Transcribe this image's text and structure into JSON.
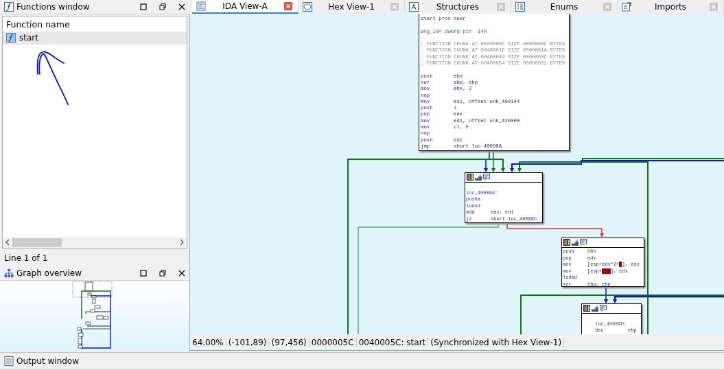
{
  "functions_window": {
    "title": "Functions window",
    "column": "Function name",
    "rows": [
      {
        "name": "start",
        "selected": true
      }
    ],
    "status": "Line 1 of 1"
  },
  "graph_overview": {
    "title": "Graph overview"
  },
  "output_window": {
    "title": "Output window"
  },
  "tabs": [
    {
      "label": "IDA View-A",
      "selected": true
    },
    {
      "label": "Hex View-1",
      "selected": false
    },
    {
      "label": "Structures",
      "selected": false
    },
    {
      "label": "Enums",
      "selected": false
    },
    {
      "label": "Imports",
      "selected": false
    }
  ],
  "nodes": [
    {
      "lines": [
        {
          "kind": "head",
          "text": "start proc near"
        },
        {
          "kind": "blank"
        },
        {
          "kind": "var",
          "text": "arg_10= dword ptr ",
          "num": " 14h"
        },
        {
          "kind": "blank"
        },
        {
          "kind": "comment",
          "text": "; FUNCTION CHUNK AT 0040000C SIZE 0000000C BYTES"
        },
        {
          "kind": "comment",
          "text": "; FUNCTION CHUNK AT 0040001E SIZE 0000001A BYTES"
        },
        {
          "kind": "comment",
          "text": "; FUNCTION CHUNK AT 00400044 SIZE 0000000C BYTES"
        },
        {
          "kind": "comment",
          "text": "; FUNCTION CHUNK AT 00400054 SIZE 00000002 BYTES"
        },
        {
          "kind": "blank"
        },
        {
          "kind": "instr",
          "mnemonic": "push",
          "operand": [
            {
              "kind": "text",
              "text": "ebx"
            }
          ]
        },
        {
          "kind": "instr",
          "mnemonic": "xor",
          "operand": [
            {
              "kind": "text",
              "text": "ebp, ebp"
            }
          ]
        },
        {
          "kind": "instr",
          "mnemonic": "mov",
          "operand": [
            {
              "kind": "text",
              "text": "ebx, "
            },
            {
              "kind": "number",
              "text": "2"
            }
          ]
        },
        {
          "kind": "instr",
          "mnemonic": "nop"
        },
        {
          "kind": "instr",
          "mnemonic": "mov",
          "operand": [
            {
              "kind": "text",
              "text": "esi, offset unk_400144"
            }
          ]
        },
        {
          "kind": "instr",
          "mnemonic": "push",
          "operand": [
            {
              "kind": "number",
              "text": "1"
            }
          ]
        },
        {
          "kind": "instr",
          "mnemonic": "pop",
          "operand": [
            {
              "kind": "text",
              "text": "eax"
            }
          ]
        },
        {
          "kind": "instr",
          "mnemonic": "mov",
          "operand": [
            {
              "kind": "text",
              "text": "edi, offset unk_420000"
            }
          ]
        },
        {
          "kind": "instr",
          "mnemonic": "mov",
          "operand": [
            {
              "kind": "text",
              "text": "cl, "
            },
            {
              "kind": "number",
              "text": "0"
            }
          ]
        },
        {
          "kind": "instr",
          "mnemonic": "nop"
        },
        {
          "kind": "instr",
          "mnemonic": "push",
          "operand": [
            {
              "kind": "text",
              "text": "edi"
            }
          ]
        },
        {
          "kind": "instr",
          "mnemonic": "jmp",
          "operand": [
            {
              "kind": "text",
              "text": "short loc 40008A"
            }
          ]
        }
      ]
    },
    {
      "lines": [
        {
          "kind": "blank"
        },
        {
          "kind": "head",
          "text": "loc_40008A:"
        },
        {
          "kind": "instr",
          "mnemonic": "pusha"
        },
        {
          "kind": "instr",
          "mnemonic": "lodsd"
        },
        {
          "kind": "instr",
          "mnemonic": "add",
          "operand": [
            {
              "kind": "text",
              "text": "eax, edi"
            }
          ]
        },
        {
          "kind": "instr",
          "mnemonic": "jz",
          "operand": [
            {
              "kind": "text",
              "text": "short loc_40008C"
            }
          ]
        }
      ]
    },
    {
      "lines": [
        {
          "kind": "instr",
          "mnemonic": "push",
          "operand": [
            {
              "kind": "number",
              "text": "0Ah"
            }
          ]
        },
        {
          "kind": "instr",
          "mnemonic": "pop",
          "operand": [
            {
              "kind": "text",
              "text": "edx"
            }
          ]
        },
        {
          "kind": "instr",
          "mnemonic": "mov",
          "operand": [
            {
              "kind": "text",
              "text": "[esp+edx*2+"
            },
            {
              "kind": "highlight",
              "text": "8"
            },
            {
              "kind": "text",
              "text": "], edx"
            }
          ]
        },
        {
          "kind": "instr",
          "mnemonic": "mov",
          "operand": [
            {
              "kind": "text",
              "text": "[esp+"
            },
            {
              "kind": "highlight",
              "text": "10h"
            },
            {
              "kind": "text",
              "text": "], edx"
            }
          ]
        },
        {
          "kind": "instr",
          "mnemonic": "lodsd"
        },
        {
          "kind": "instr",
          "mnemonic": "xor",
          "operand": [
            {
              "kind": "text",
              "text": "ebp, ebp"
            }
          ]
        }
      ]
    },
    {
      "lines": [
        {
          "kind": "blank"
        },
        {
          "kind": "head",
          "text": "loc_40009D:"
        },
        {
          "kind": "instr",
          "mnemonic": "dec",
          "operand": [
            {
              "kind": "text",
              "text": "ebp"
            }
          ]
        }
      ]
    }
  ],
  "status_bar": [
    "64.00%",
    "(-101,89)",
    "(97,456)",
    "0000005C",
    "0040005C: start",
    "(Synchronized with Hex View-1)"
  ]
}
